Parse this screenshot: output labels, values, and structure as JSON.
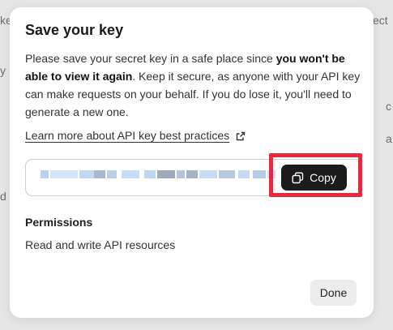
{
  "background": {
    "fragments": [
      "ke",
      "ect",
      "y",
      "d",
      "c",
      "a"
    ]
  },
  "modal": {
    "title": "Save your key",
    "description": {
      "part1": "Please save your secret key in a safe place since ",
      "bold": "you won't be able to view it again",
      "part2": ". Keep it secure, as anyone with your API key can make requests on your behalf. If you do lose it, you'll need to generate a new one."
    },
    "learn_more_link": "Learn more about API key best practices",
    "copy_button": "Copy",
    "permissions": {
      "title": "Permissions",
      "value": "Read and write API resources"
    },
    "done_button": "Done"
  },
  "colors": {
    "highlight": "#e8283e",
    "copy_bg": "#1b1b1b",
    "done_bg": "#ececec",
    "blur_light": "#c9dcf5",
    "blur_dark": "#a9b7cc"
  }
}
